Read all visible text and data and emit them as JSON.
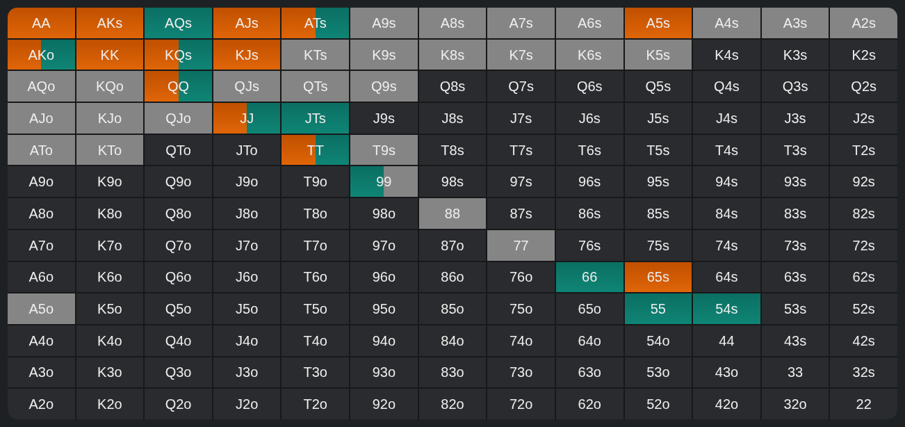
{
  "rows": [
    {
      "cells": [
        {
          "hand": "AA",
          "segments": [
            {
              "kind": "raise",
              "level": 1
            }
          ]
        },
        {
          "hand": "AKs",
          "segments": [
            {
              "kind": "raise",
              "level": 1
            }
          ]
        },
        {
          "hand": "AQs",
          "segments": [
            {
              "kind": "call",
              "level": 1
            }
          ]
        },
        {
          "hand": "AJs",
          "segments": [
            {
              "kind": "raise",
              "level": 1
            }
          ]
        },
        {
          "hand": "ATs",
          "segments": [
            {
              "kind": "raise",
              "level": 0.5
            },
            {
              "kind": "call",
              "level": 0.5
            }
          ]
        },
        {
          "hand": "A9s",
          "segments": [
            {
              "kind": "fold",
              "level": 1
            }
          ]
        },
        {
          "hand": "A8s",
          "segments": [
            {
              "kind": "fold",
              "level": 1
            }
          ]
        },
        {
          "hand": "A7s",
          "segments": [
            {
              "kind": "fold",
              "level": 1
            }
          ]
        },
        {
          "hand": "A6s",
          "segments": [
            {
              "kind": "fold",
              "level": 1
            }
          ]
        },
        {
          "hand": "A5s",
          "segments": [
            {
              "kind": "raise",
              "level": 1
            }
          ]
        },
        {
          "hand": "A4s",
          "segments": [
            {
              "kind": "fold",
              "level": 1
            }
          ]
        },
        {
          "hand": "A3s",
          "segments": [
            {
              "kind": "fold",
              "level": 1
            }
          ]
        },
        {
          "hand": "A2s",
          "segments": [
            {
              "kind": "fold",
              "level": 1
            }
          ]
        }
      ]
    },
    {
      "cells": [
        {
          "hand": "AKo",
          "segments": [
            {
              "kind": "raise",
              "level": 0.5
            },
            {
              "kind": "call",
              "level": 0.5
            }
          ]
        },
        {
          "hand": "KK",
          "segments": [
            {
              "kind": "raise",
              "level": 1
            }
          ]
        },
        {
          "hand": "KQs",
          "segments": [
            {
              "kind": "raise",
              "level": 0.5
            },
            {
              "kind": "call",
              "level": 0.5
            }
          ]
        },
        {
          "hand": "KJs",
          "segments": [
            {
              "kind": "raise",
              "level": 1
            }
          ]
        },
        {
          "hand": "KTs",
          "segments": [
            {
              "kind": "fold",
              "level": 1
            }
          ]
        },
        {
          "hand": "K9s",
          "segments": [
            {
              "kind": "fold",
              "level": 1
            }
          ]
        },
        {
          "hand": "K8s",
          "segments": [
            {
              "kind": "fold",
              "level": 1
            }
          ]
        },
        {
          "hand": "K7s",
          "segments": [
            {
              "kind": "fold",
              "level": 1
            }
          ]
        },
        {
          "hand": "K6s",
          "segments": [
            {
              "kind": "fold",
              "level": 1
            }
          ]
        },
        {
          "hand": "K5s",
          "segments": [
            {
              "kind": "fold",
              "level": 1
            }
          ]
        },
        {
          "hand": "K4s"
        },
        {
          "hand": "K3s"
        },
        {
          "hand": "K2s"
        }
      ]
    },
    {
      "cells": [
        {
          "hand": "AQo",
          "segments": [
            {
              "kind": "fold",
              "level": 1
            }
          ]
        },
        {
          "hand": "KQo",
          "segments": [
            {
              "kind": "fold",
              "level": 1
            }
          ]
        },
        {
          "hand": "QQ",
          "segments": [
            {
              "kind": "raise",
              "level": 0.5
            },
            {
              "kind": "call",
              "level": 0.5
            }
          ]
        },
        {
          "hand": "QJs",
          "segments": [
            {
              "kind": "fold",
              "level": 1
            }
          ]
        },
        {
          "hand": "QTs",
          "segments": [
            {
              "kind": "fold",
              "level": 1
            }
          ]
        },
        {
          "hand": "Q9s",
          "segments": [
            {
              "kind": "fold",
              "level": 1
            }
          ]
        },
        {
          "hand": "Q8s"
        },
        {
          "hand": "Q7s"
        },
        {
          "hand": "Q6s"
        },
        {
          "hand": "Q5s"
        },
        {
          "hand": "Q4s"
        },
        {
          "hand": "Q3s"
        },
        {
          "hand": "Q2s"
        }
      ]
    },
    {
      "cells": [
        {
          "hand": "AJo",
          "segments": [
            {
              "kind": "fold",
              "level": 1
            }
          ]
        },
        {
          "hand": "KJo",
          "segments": [
            {
              "kind": "fold",
              "level": 1
            }
          ]
        },
        {
          "hand": "QJo",
          "segments": [
            {
              "kind": "fold",
              "level": 1
            }
          ]
        },
        {
          "hand": "JJ",
          "segments": [
            {
              "kind": "raise",
              "level": 0.5
            },
            {
              "kind": "call",
              "level": 0.5
            }
          ]
        },
        {
          "hand": "JTs",
          "segments": [
            {
              "kind": "call",
              "level": 1
            }
          ]
        },
        {
          "hand": "J9s"
        },
        {
          "hand": "J8s"
        },
        {
          "hand": "J7s"
        },
        {
          "hand": "J6s"
        },
        {
          "hand": "J5s"
        },
        {
          "hand": "J4s"
        },
        {
          "hand": "J3s"
        },
        {
          "hand": "J2s"
        }
      ]
    },
    {
      "cells": [
        {
          "hand": "ATo",
          "segments": [
            {
              "kind": "fold",
              "level": 1
            }
          ]
        },
        {
          "hand": "KTo",
          "segments": [
            {
              "kind": "fold",
              "level": 1
            }
          ]
        },
        {
          "hand": "QTo"
        },
        {
          "hand": "JTo"
        },
        {
          "hand": "TT",
          "segments": [
            {
              "kind": "raise",
              "level": 0.5
            },
            {
              "kind": "call",
              "level": 0.5
            }
          ]
        },
        {
          "hand": "T9s",
          "segments": [
            {
              "kind": "fold",
              "level": 1
            }
          ]
        },
        {
          "hand": "T8s"
        },
        {
          "hand": "T7s"
        },
        {
          "hand": "T6s"
        },
        {
          "hand": "T5s"
        },
        {
          "hand": "T4s"
        },
        {
          "hand": "T3s"
        },
        {
          "hand": "T2s"
        }
      ]
    },
    {
      "cells": [
        {
          "hand": "A9o"
        },
        {
          "hand": "K9o"
        },
        {
          "hand": "Q9o"
        },
        {
          "hand": "J9o"
        },
        {
          "hand": "T9o"
        },
        {
          "hand": "99",
          "segments": [
            {
              "kind": "call",
              "level": 0.5
            },
            {
              "kind": "fold",
              "level": 0.5
            }
          ]
        },
        {
          "hand": "98s"
        },
        {
          "hand": "97s"
        },
        {
          "hand": "96s"
        },
        {
          "hand": "95s"
        },
        {
          "hand": "94s"
        },
        {
          "hand": "93s"
        },
        {
          "hand": "92s"
        }
      ]
    },
    {
      "cells": [
        {
          "hand": "A8o"
        },
        {
          "hand": "K8o"
        },
        {
          "hand": "Q8o"
        },
        {
          "hand": "J8o"
        },
        {
          "hand": "T8o"
        },
        {
          "hand": "98o"
        },
        {
          "hand": "88",
          "segments": [
            {
              "kind": "fold",
              "level": 1
            }
          ]
        },
        {
          "hand": "87s"
        },
        {
          "hand": "86s"
        },
        {
          "hand": "85s"
        },
        {
          "hand": "84s"
        },
        {
          "hand": "83s"
        },
        {
          "hand": "82s"
        }
      ]
    },
    {
      "cells": [
        {
          "hand": "A7o"
        },
        {
          "hand": "K7o"
        },
        {
          "hand": "Q7o"
        },
        {
          "hand": "J7o"
        },
        {
          "hand": "T7o"
        },
        {
          "hand": "97o"
        },
        {
          "hand": "87o"
        },
        {
          "hand": "77",
          "segments": [
            {
              "kind": "fold",
              "level": 1
            }
          ]
        },
        {
          "hand": "76s"
        },
        {
          "hand": "75s"
        },
        {
          "hand": "74s"
        },
        {
          "hand": "73s"
        },
        {
          "hand": "72s"
        }
      ]
    },
    {
      "cells": [
        {
          "hand": "A6o"
        },
        {
          "hand": "K6o"
        },
        {
          "hand": "Q6o"
        },
        {
          "hand": "J6o"
        },
        {
          "hand": "T6o"
        },
        {
          "hand": "96o"
        },
        {
          "hand": "86o"
        },
        {
          "hand": "76o"
        },
        {
          "hand": "66",
          "segments": [
            {
              "kind": "call",
              "level": 1
            }
          ]
        },
        {
          "hand": "65s",
          "segments": [
            {
              "kind": "raise",
              "level": 1
            }
          ]
        },
        {
          "hand": "64s"
        },
        {
          "hand": "63s"
        },
        {
          "hand": "62s"
        }
      ]
    },
    {
      "cells": [
        {
          "hand": "A5o",
          "segments": [
            {
              "kind": "fold",
              "level": 1
            }
          ]
        },
        {
          "hand": "K5o"
        },
        {
          "hand": "Q5o"
        },
        {
          "hand": "J5o"
        },
        {
          "hand": "T5o"
        },
        {
          "hand": "95o"
        },
        {
          "hand": "85o"
        },
        {
          "hand": "75o"
        },
        {
          "hand": "65o"
        },
        {
          "hand": "55",
          "segments": [
            {
              "kind": "call",
              "level": 1
            }
          ]
        },
        {
          "hand": "54s",
          "segments": [
            {
              "kind": "call",
              "level": 1
            }
          ]
        },
        {
          "hand": "53s"
        },
        {
          "hand": "52s"
        }
      ]
    },
    {
      "cells": [
        {
          "hand": "A4o"
        },
        {
          "hand": "K4o"
        },
        {
          "hand": "Q4o"
        },
        {
          "hand": "J4o"
        },
        {
          "hand": "T4o"
        },
        {
          "hand": "94o"
        },
        {
          "hand": "84o"
        },
        {
          "hand": "74o"
        },
        {
          "hand": "64o"
        },
        {
          "hand": "54o"
        },
        {
          "hand": "44"
        },
        {
          "hand": "43s"
        },
        {
          "hand": "42s"
        }
      ]
    },
    {
      "cells": [
        {
          "hand": "A3o"
        },
        {
          "hand": "K3o"
        },
        {
          "hand": "Q3o"
        },
        {
          "hand": "J3o"
        },
        {
          "hand": "T3o"
        },
        {
          "hand": "93o"
        },
        {
          "hand": "83o"
        },
        {
          "hand": "73o"
        },
        {
          "hand": "63o"
        },
        {
          "hand": "53o"
        },
        {
          "hand": "43o"
        },
        {
          "hand": "33"
        },
        {
          "hand": "32s"
        }
      ]
    },
    {
      "cells": [
        {
          "hand": "A2o"
        },
        {
          "hand": "K2o"
        },
        {
          "hand": "Q2o"
        },
        {
          "hand": "J2o"
        },
        {
          "hand": "T2o"
        },
        {
          "hand": "92o"
        },
        {
          "hand": "82o"
        },
        {
          "hand": "72o"
        },
        {
          "hand": "62o"
        },
        {
          "hand": "52o"
        },
        {
          "hand": "42o"
        },
        {
          "hand": "32o"
        },
        {
          "hand": "22"
        }
      ]
    }
  ]
}
